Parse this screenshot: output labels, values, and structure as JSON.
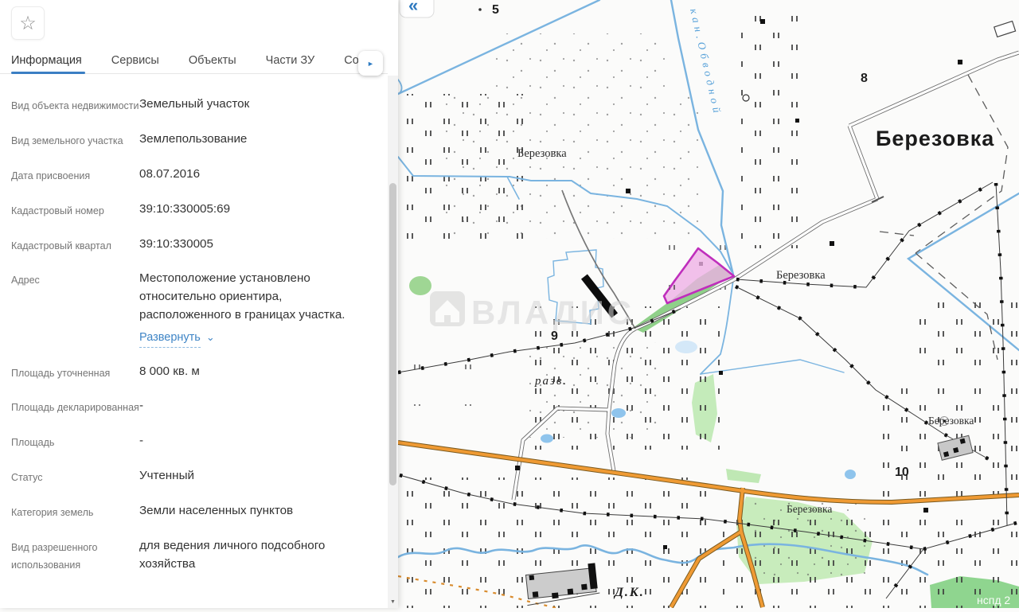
{
  "panel": {
    "tabs": [
      "Информация",
      "Сервисы",
      "Объекты",
      "Части ЗУ",
      "Соста"
    ],
    "fields": [
      {
        "label": "Вид объекта недвижимости",
        "value": "Земельный участок"
      },
      {
        "label": "Вид земельного участка",
        "value": "Землепользование"
      },
      {
        "label": "Дата присвоения",
        "value": "08.07.2016"
      },
      {
        "label": "Кадастровый номер",
        "value": "39:10:330005:69"
      },
      {
        "label": "Кадастровый квартал",
        "value": "39:10:330005"
      },
      {
        "label": "Адрес",
        "value": "Местоположение установлено относительно ориентира, расположенного в границах участка.",
        "link": "Развернуть"
      },
      {
        "label": "Площадь уточненная",
        "value": "8 000 кв. м"
      },
      {
        "label": "Площадь декларированная",
        "value": "-"
      },
      {
        "label": "Площадь",
        "value": "-"
      },
      {
        "label": "Статус",
        "value": "Учтенный"
      },
      {
        "label": "Категория земель",
        "value": "Земли населенных пунктов"
      },
      {
        "label": "Вид разрешенного использования",
        "value": "для ведения личного подсобного хозяйства"
      }
    ]
  },
  "icons": {
    "favorite": "☆",
    "tabs_scroll_right": "►",
    "scrollbar_down": "▼",
    "collapse": "«",
    "expand_chevron": "⌄"
  },
  "map": {
    "watermark": "ВЛАДИС",
    "labels": {
      "settlement_big": "Березовка",
      "settlements": [
        "Березовка",
        "Березовка",
        "Березовка",
        "Березовка"
      ],
      "canal": "кан.Обводной",
      "ruins": "разв.",
      "dk": "Д.К.",
      "num_5": "5",
      "num_8": "8",
      "num_9": "9",
      "num_10": "10",
      "nspd": "нспд 2"
    },
    "colors": {
      "parcel_fill": "#eeb0e6",
      "parcel_stroke": "#bf2ebc",
      "road_orange": "#ef9a33",
      "water": "#7ab4e0",
      "green": "#a8dba0"
    }
  }
}
